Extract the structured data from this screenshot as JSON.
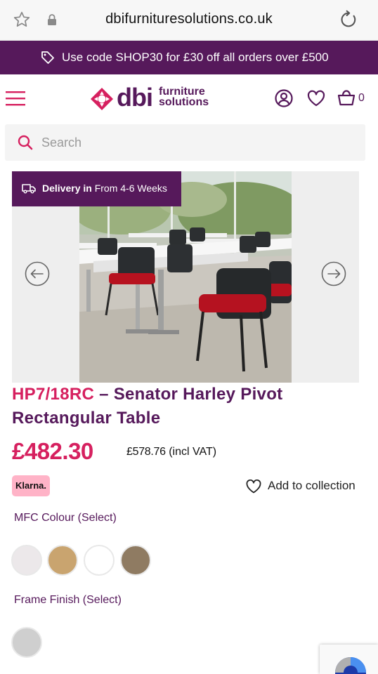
{
  "browser": {
    "url": "dbifurnituresolutions.co.uk"
  },
  "promo": {
    "text": "Use code SHOP30 for £30 off all orders over £500"
  },
  "header": {
    "logo_main": "dbi",
    "logo_sub_1": "furniture",
    "logo_sub_2": "solutions",
    "basket_count": "0"
  },
  "search": {
    "placeholder": "Search"
  },
  "gallery": {
    "delivery_bold": "Delivery in",
    "delivery_rest": "From 4-6 Weeks"
  },
  "product": {
    "code": "HP7/18RC",
    "title_rest": " – Senator Harley Pivot Rectangular Table",
    "price": "£482.30",
    "vat_price": "£578.76",
    "vat_label": "(incl VAT)",
    "klarna": "Klarna.",
    "add_to_collection": "Add to collection"
  },
  "options": {
    "mfc_label": "MFC Colour (Select)",
    "mfc_swatches": [
      "#ece8ea",
      "#c9a46f",
      "#ffffff",
      "#8f7b62"
    ],
    "frame_label": "Frame Finish (Select)",
    "frame_swatches": [
      "#cfcfcf"
    ]
  },
  "colors": {
    "brand_purple": "#56195b",
    "brand_pink": "#d6205f",
    "klarna_pink": "#ffb3c7"
  }
}
